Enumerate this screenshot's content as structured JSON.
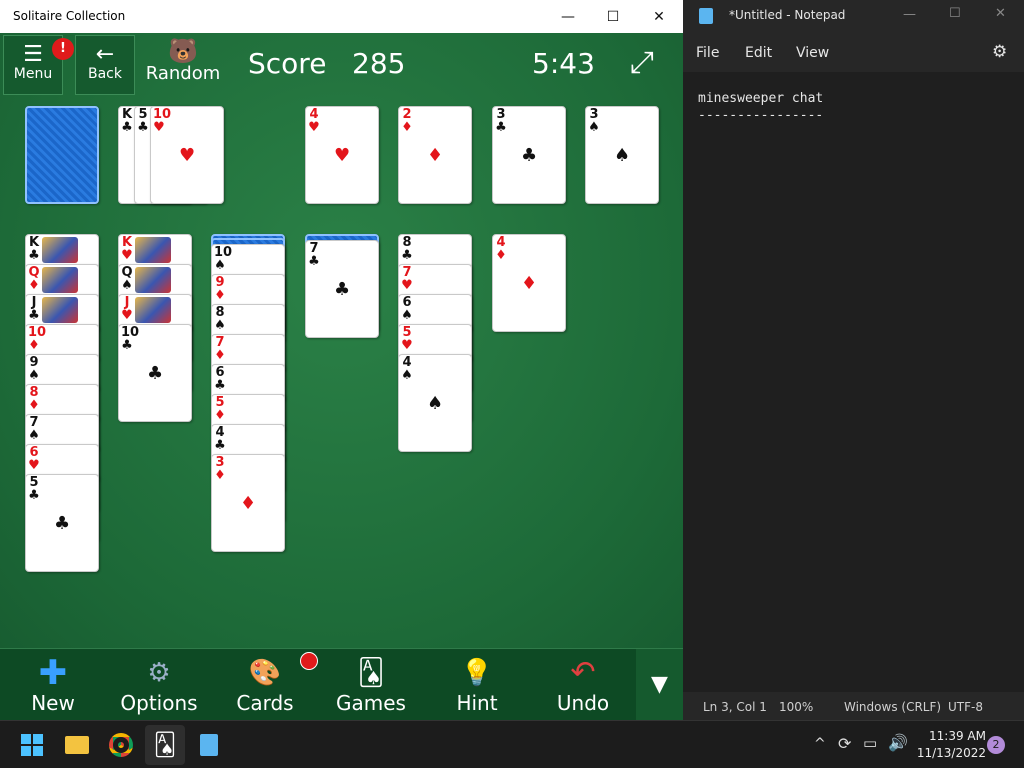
{
  "solitaire": {
    "title": "Solitaire Collection",
    "menu_label": "Menu",
    "menu_badge": "!",
    "back_label": "Back",
    "mode_label": "Random",
    "score_label": "Score",
    "score_value": "285",
    "time": "5:43",
    "bottom": [
      "New",
      "Options",
      "Cards",
      "Games",
      "Hint",
      "Undo"
    ],
    "foundations": [
      {
        "rank": "4",
        "suit": "♥",
        "color": "r"
      },
      {
        "rank": "2",
        "suit": "♦",
        "color": "r"
      },
      {
        "rank": "3",
        "suit": "♣",
        "color": "k"
      },
      {
        "rank": "3",
        "suit": "♠",
        "color": "k"
      }
    ],
    "waste": [
      {
        "rank": "K",
        "suit": "♣",
        "color": "k"
      },
      {
        "rank": "5",
        "suit": "♣",
        "color": "k"
      },
      {
        "rank": "10",
        "suit": "♥",
        "color": "r"
      }
    ],
    "tableau": [
      [
        {
          "rank": "K",
          "suit": "♣",
          "color": "k"
        },
        {
          "rank": "Q",
          "suit": "♦",
          "color": "r"
        },
        {
          "rank": "J",
          "suit": "♣",
          "color": "k"
        },
        {
          "rank": "10",
          "suit": "♦",
          "color": "r"
        },
        {
          "rank": "9",
          "suit": "♠",
          "color": "k"
        },
        {
          "rank": "8",
          "suit": "♦",
          "color": "r"
        },
        {
          "rank": "7",
          "suit": "♠",
          "color": "k"
        },
        {
          "rank": "6",
          "suit": "♥",
          "color": "r"
        },
        {
          "rank": "5",
          "suit": "♣",
          "color": "k"
        }
      ],
      [
        {
          "rank": "K",
          "suit": "♥",
          "color": "r"
        },
        {
          "rank": "Q",
          "suit": "♠",
          "color": "k"
        },
        {
          "rank": "J",
          "suit": "♥",
          "color": "r"
        },
        {
          "rank": "10",
          "suit": "♣",
          "color": "k"
        }
      ],
      [
        {
          "rank": "10",
          "suit": "♠",
          "color": "k"
        },
        {
          "rank": "9",
          "suit": "♦",
          "color": "r"
        },
        {
          "rank": "8",
          "suit": "♠",
          "color": "k"
        },
        {
          "rank": "7",
          "suit": "♦",
          "color": "r"
        },
        {
          "rank": "6",
          "suit": "♣",
          "color": "k"
        },
        {
          "rank": "5",
          "suit": "♦",
          "color": "r"
        },
        {
          "rank": "4",
          "suit": "♣",
          "color": "k"
        },
        {
          "rank": "3",
          "suit": "♦",
          "color": "r"
        }
      ],
      [
        {
          "rank": "7",
          "suit": "♣",
          "color": "k"
        }
      ],
      [
        {
          "rank": "8",
          "suit": "♣",
          "color": "k"
        },
        {
          "rank": "7",
          "suit": "♥",
          "color": "r"
        },
        {
          "rank": "6",
          "suit": "♠",
          "color": "k"
        },
        {
          "rank": "5",
          "suit": "♥",
          "color": "r"
        },
        {
          "rank": "4",
          "suit": "♠",
          "color": "k"
        }
      ],
      [
        {
          "rank": "4",
          "suit": "♦",
          "color": "r"
        }
      ]
    ]
  },
  "notepad": {
    "title": "*Untitled - Notepad",
    "menu": [
      "File",
      "Edit",
      "View"
    ],
    "line1": "minesweeper chat",
    "line2": "----------------",
    "status_pos": "Ln 3, Col 1",
    "status_zoom": "100%",
    "status_eol": "Windows (CRLF)",
    "status_enc": "UTF-8"
  },
  "taskbar": {
    "time": "11:39 AM",
    "date": "11/13/2022",
    "notif": "2"
  }
}
